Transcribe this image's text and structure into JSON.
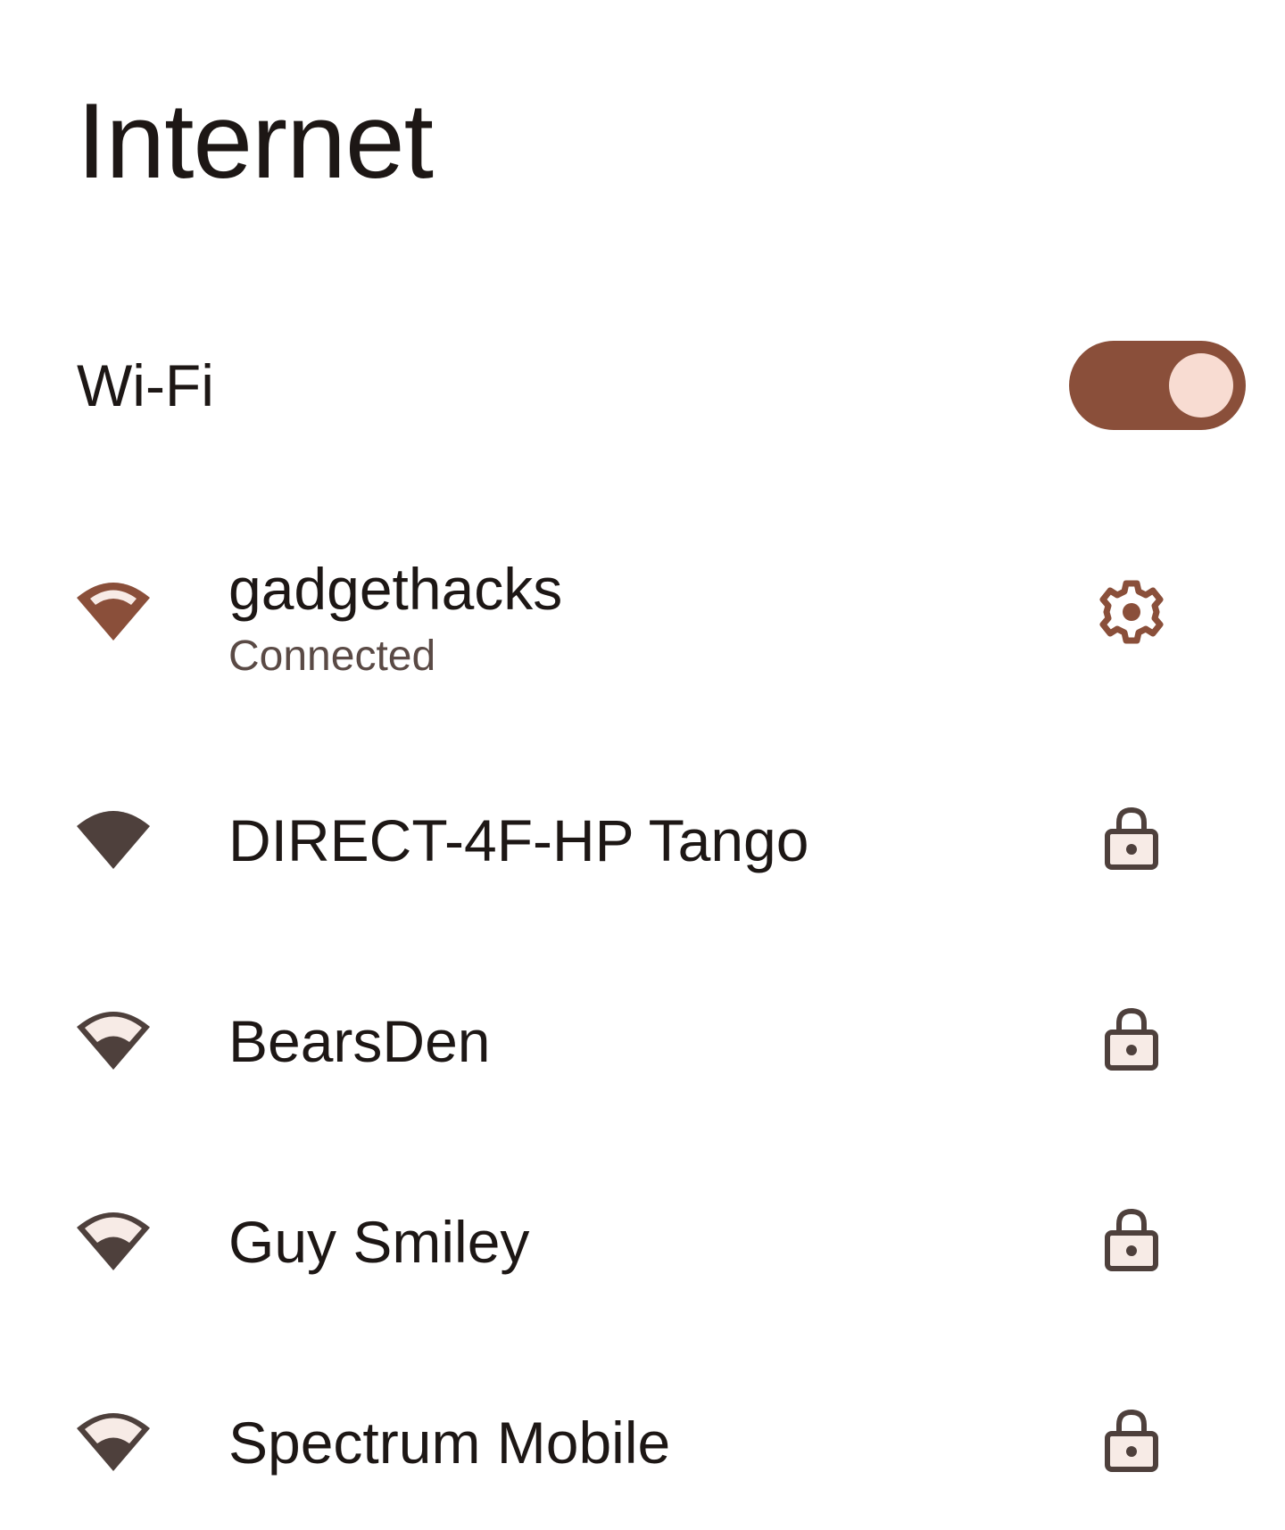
{
  "page": {
    "title": "Internet"
  },
  "wifi": {
    "label": "Wi-Fi",
    "enabled": true
  },
  "networks": [
    {
      "name": "gadgethacks",
      "status": "Connected",
      "signal_icon": "wifi-signal-full-icon",
      "trailing_icon": "gear-icon"
    },
    {
      "name": "DIRECT-4F-HP Tango",
      "signal_icon": "wifi-signal-full-icon",
      "trailing_icon": "lock-icon"
    },
    {
      "name": "BearsDen",
      "signal_icon": "wifi-signal-partial-icon",
      "trailing_icon": "lock-icon"
    },
    {
      "name": "Guy Smiley",
      "signal_icon": "wifi-signal-partial-icon",
      "trailing_icon": "lock-icon"
    },
    {
      "name": "Spectrum Mobile",
      "signal_icon": "wifi-signal-partial-icon",
      "trailing_icon": "lock-icon"
    }
  ],
  "colors": {
    "accent": "#8a4f3a",
    "toggle_knob": "#f8dcd2",
    "icon_dark": "#4e403c",
    "icon_light": "#f7ebe6",
    "text": "#1d1715",
    "secondary_text": "#5a4a45"
  }
}
